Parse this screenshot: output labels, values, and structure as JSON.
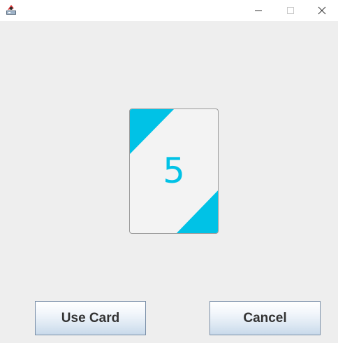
{
  "window": {
    "icon": "java-app-icon",
    "controls": [
      "minimize-icon",
      "maximize-icon",
      "close-icon"
    ]
  },
  "card": {
    "value": "5",
    "accent_color": "#00c2e6"
  },
  "buttons": {
    "use_card_label": "Use Card",
    "cancel_label": "Cancel"
  }
}
